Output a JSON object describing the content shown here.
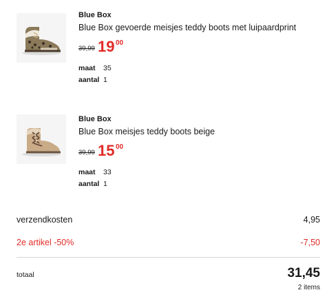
{
  "products": [
    {
      "brand": "Blue Box",
      "title": "Blue Box gevoerde meisjes teddy boots met luipaardprint",
      "old_price": "39,99",
      "new_price_int": "19",
      "new_price_cents": "00",
      "size_label": "maat",
      "size": "35",
      "qty_label": "aantal",
      "qty": "1"
    },
    {
      "brand": "Blue Box",
      "title": "Blue Box meisjes teddy boots beige",
      "old_price": "39,99",
      "new_price_int": "15",
      "new_price_cents": "00",
      "size_label": "maat",
      "size": "33",
      "qty_label": "aantal",
      "qty": "1"
    }
  ],
  "summary": {
    "shipping_label": "verzendkosten",
    "shipping_value": "4,95",
    "discount_label": "2e artikel -50%",
    "discount_value": "-7,50",
    "total_label": "totaal",
    "total_value": "31,45",
    "items_count": "2 items"
  },
  "colors": {
    "accent_red": "#e02b27",
    "text": "#1a1a1a",
    "thumb_bg": "#f5f5f5"
  }
}
